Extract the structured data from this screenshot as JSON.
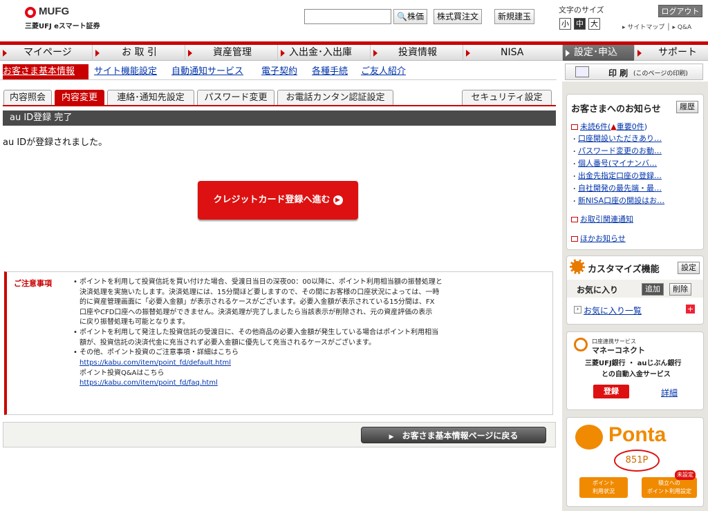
{
  "header": {
    "brand": "MUFG",
    "sub": "三菱UFJ eスマート証券",
    "search_btn": "株価",
    "order_btn": "株式買注文",
    "new_btn": "新規建玉",
    "font_size_label": "文字のサイズ",
    "font_sizes": [
      "小",
      "中",
      "大"
    ],
    "logout": "ログアウト",
    "links": "▸ サイトマップ │ ▸ Q&A"
  },
  "nav": {
    "items": [
      "マイページ",
      "お 取 引",
      "資産管理",
      "入出金･入出庫",
      "投資情報",
      "NISA",
      "設定･申込",
      "サポート"
    ]
  },
  "subnav": {
    "items": [
      "お客さま基本情報",
      "サイト機能設定",
      "自動通知サービス",
      "電子契約",
      "各種手続",
      "ご友人紹介"
    ],
    "print": "印 刷",
    "print_note": "(このページの印刷)"
  },
  "tabs": [
    "内容照会",
    "内容変更",
    "連絡･通知先設定",
    "パスワード変更",
    "お電話カンタン認証設定"
  ],
  "security_tab": "セキュリティ設定",
  "main": {
    "title": "au ID登録 完了",
    "message": "au IDが登録されました。",
    "cc_button": "クレジットカード登録へ進む"
  },
  "notice": {
    "label": "ご注意事項",
    "lines": [
      "ポイントを利用して投資信託を買い付けた場合、受渡日当日の深夜00：00以降に、ポイント利用相当額の振替処理と",
      "決済処理を実施いたします。決済処理には、15分間ほど要しますので、その間にお客様の口座状況によっては、一時",
      "的に資産管理画面に「必要入金額」が表示されるケースがございます。必要入金額が表示されている15分間は、FX",
      "口座やCFD口座への振替処理ができません。決済処理が完了しましたら当該表示が削除され、元の資産評価の表示",
      "に戻り振替処理も可能となります。",
      "ポイントを利用して発注した投資信託の受渡日に、その他商品の必要入金額が発生している場合はポイント利用相当",
      "額が、投資信託の決済代金に充当されず必要入金額に優先して充当されるケースがございます。",
      "その他、ポイント投資のご注意事項・詳細はこちら"
    ],
    "link1": "https://kabu.com/item/point_fd/default.html",
    "qa": "ポイント投資Q&Aはこちら",
    "link2": "https://kabu.com/item/point_fd/faq.html"
  },
  "back_button": "お客さま基本情報ページに戻る",
  "sidebar": {
    "info_title": "お客さまへのお知らせ",
    "history_btn": "履歴",
    "unread": "未読6件(",
    "important": "重要0件",
    "news": [
      "口座開設いただきあり…",
      "パスワード変更のお動…",
      "個人番号(マイナンバ…",
      "出金先指定口座の登録…",
      "自社開発の最先端・最…",
      "新NISA口座の開設はお…"
    ],
    "trade_notice": "お取引関連通知",
    "other_notice": "ほかお知らせ",
    "customize_title": "カスタマイズ機能",
    "setting_btn": "設定",
    "fav_label": "お気に入り",
    "add_btn": "追加",
    "del_btn": "削除",
    "fav_list": "お気に入り一覧",
    "mc_small": "口座連携サービス",
    "mc_title": "マネーコネクト",
    "mc_desc1": "三菱UFJ銀行 ・ auじぶん銀行",
    "mc_desc2": "との自動入金サービス",
    "mc_register": "登録",
    "mc_detail": "詳細",
    "ponta": "Ponta",
    "points": "851P",
    "pt_status1": "ポイント",
    "pt_status2": "利用状況",
    "pt_set1": "積立への",
    "pt_set2": "ポイント利用設定",
    "unset": "未設定"
  }
}
